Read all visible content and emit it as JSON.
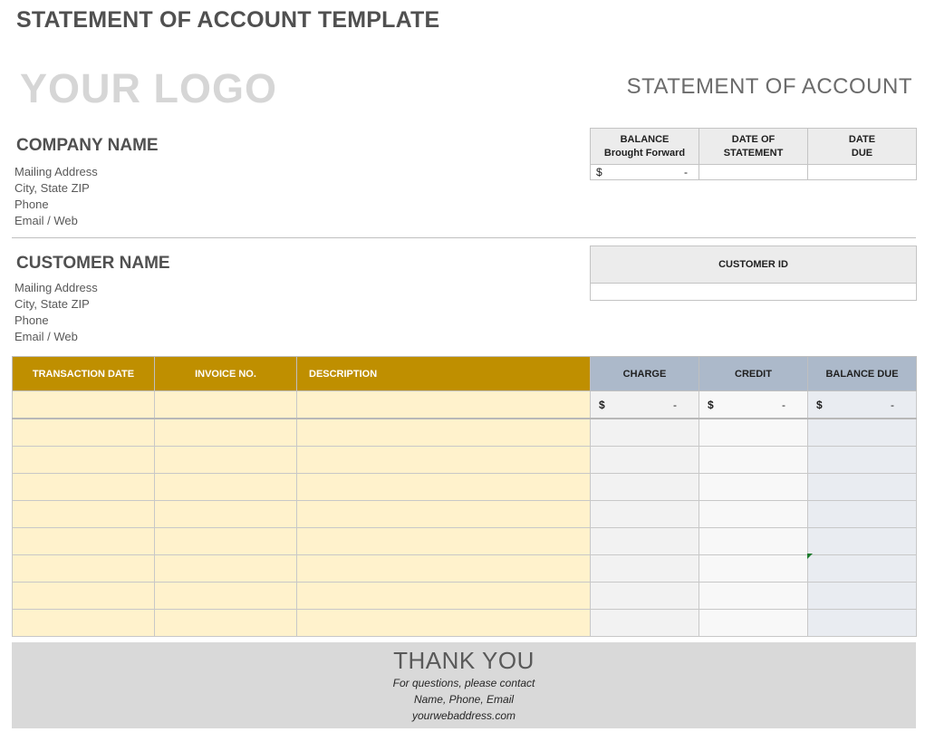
{
  "template_title": "STATEMENT OF ACCOUNT TEMPLATE",
  "logo_text": "YOUR LOGO",
  "statement_title": "STATEMENT OF ACCOUNT",
  "company": {
    "name": "COMPANY NAME",
    "lines": [
      "Mailing Address",
      "City, State ZIP",
      "Phone",
      "Email / Web"
    ]
  },
  "customer": {
    "name": "CUSTOMER NAME",
    "lines": [
      "Mailing Address",
      "City, State ZIP",
      "Phone",
      "Email / Web"
    ]
  },
  "header_box": {
    "balance_label_line1": "BALANCE",
    "balance_label_line2": "Brought Forward",
    "date_of_statement_label": "DATE OF STATEMENT",
    "date_due_label_line1": "DATE",
    "date_due_label_line2": "DUE",
    "balance_currency": "$",
    "balance_value": "-",
    "date_of_statement_value": "",
    "date_due_value": ""
  },
  "customer_id": {
    "label": "CUSTOMER ID",
    "value": ""
  },
  "transactions": {
    "columns": [
      "TRANSACTION DATE",
      "INVOICE NO.",
      "DESCRIPTION",
      "CHARGE",
      "CREDIT",
      "BALANCE DUE"
    ],
    "first_row": {
      "charge_currency": "$",
      "charge_value": "-",
      "credit_currency": "$",
      "credit_value": "-",
      "balance_currency": "$",
      "balance_value": "-"
    },
    "empty_rows": 8
  },
  "footer": {
    "thank_you": "THANK YOU",
    "contact_line1": "For questions, please contact",
    "contact_line2": "Name, Phone, Email",
    "contact_line3": "yourwebaddress.com"
  },
  "colors": {
    "header_gold": "#bf8f00",
    "header_blue": "#acb9ca",
    "row_yellow": "#fff2cc",
    "footer_gray": "#d9d9d9"
  }
}
